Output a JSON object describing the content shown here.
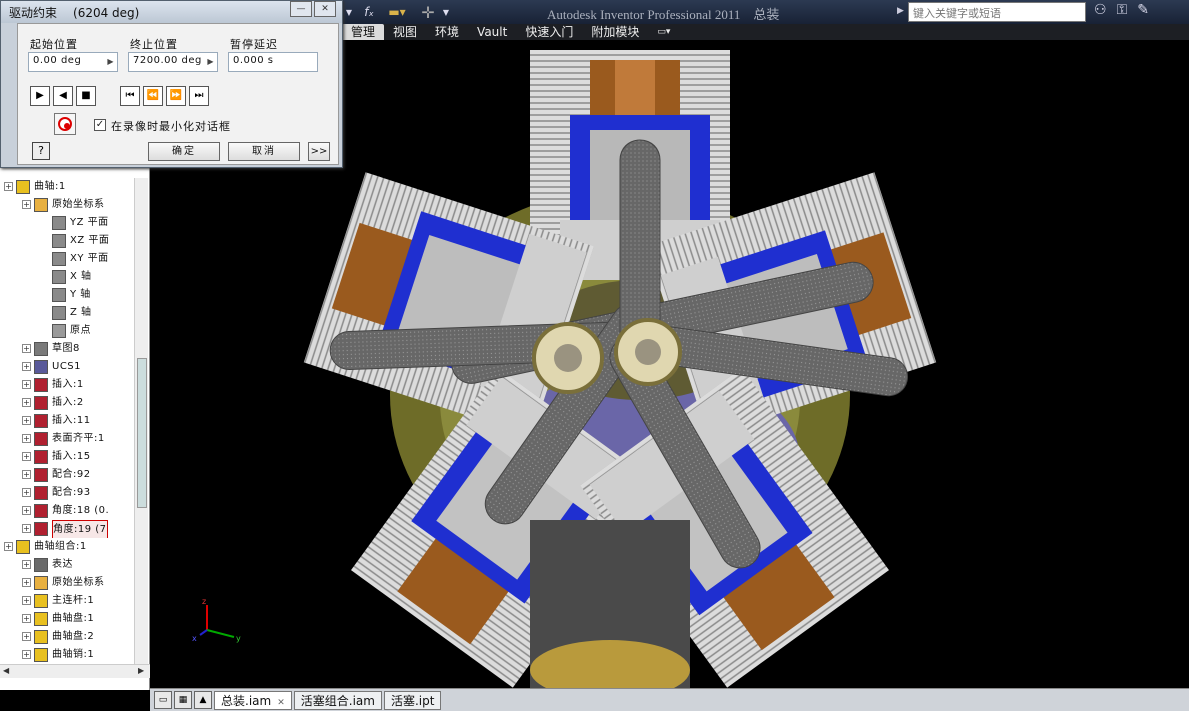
{
  "dialog": {
    "title": "驱动约束",
    "current_value": "(6204 deg)",
    "start_label": "起始位置",
    "start_value": "0.00 deg",
    "end_label": "终止位置",
    "end_value": "7200.00 deg",
    "pause_label": "暂停延迟",
    "pause_value": "0.000 s",
    "record_checkbox_label": "在录像时最小化对话框",
    "record_checkbox_checked": true,
    "ok_label": "确定",
    "cancel_label": "取消",
    "more_label": ">>",
    "help_label": "?"
  },
  "titlebar": {
    "app_title": "Autodesk Inventor Professional 2011",
    "doc_title": "总装",
    "search_placeholder": "键入关键字或短语"
  },
  "menu": [
    "管理",
    "视图",
    "环境",
    "Vault",
    "快速入门",
    "附加模块"
  ],
  "tree": [
    {
      "label": "曲轴:1",
      "indent": 0,
      "icon": "part-icon"
    },
    {
      "label": "原始坐标系",
      "indent": 1,
      "icon": "folder-icon"
    },
    {
      "label": "YZ 平面",
      "indent": 2,
      "icon": "plane-icon"
    },
    {
      "label": "XZ 平面",
      "indent": 2,
      "icon": "plane-icon"
    },
    {
      "label": "XY 平面",
      "indent": 2,
      "icon": "plane-icon"
    },
    {
      "label": "X 轴",
      "indent": 2,
      "icon": "axis-icon"
    },
    {
      "label": "Y 轴",
      "indent": 2,
      "icon": "axis-icon"
    },
    {
      "label": "Z 轴",
      "indent": 2,
      "icon": "axis-icon"
    },
    {
      "label": "原点",
      "indent": 2,
      "icon": "origin-icon"
    },
    {
      "label": "草图8",
      "indent": 1,
      "icon": "sketch-icon"
    },
    {
      "label": "UCS1",
      "indent": 1,
      "icon": "ucs-icon"
    },
    {
      "label": "插入:1",
      "indent": 1,
      "icon": "insert-icon"
    },
    {
      "label": "插入:2",
      "indent": 1,
      "icon": "insert-icon"
    },
    {
      "label": "插入:11",
      "indent": 1,
      "icon": "insert-icon"
    },
    {
      "label": "表面齐平:1",
      "indent": 1,
      "icon": "flush-icon"
    },
    {
      "label": "插入:15",
      "indent": 1,
      "icon": "insert-icon"
    },
    {
      "label": "配合:92",
      "indent": 1,
      "icon": "mate-icon"
    },
    {
      "label": "配合:93",
      "indent": 1,
      "icon": "mate-icon"
    },
    {
      "label": "角度:18 (0.",
      "indent": 1,
      "icon": "angle-icon"
    },
    {
      "label": "角度:19 (7",
      "indent": 1,
      "icon": "angle-icon",
      "selected": true
    },
    {
      "label": "曲轴组合:1",
      "indent": 0,
      "icon": "assembly-icon"
    },
    {
      "label": "表达",
      "indent": 1,
      "icon": "representation-icon"
    },
    {
      "label": "原始坐标系",
      "indent": 1,
      "icon": "folder-icon"
    },
    {
      "label": "主连杆:1",
      "indent": 1,
      "icon": "part-icon"
    },
    {
      "label": "曲轴盘:1",
      "indent": 1,
      "icon": "part-icon"
    },
    {
      "label": "曲轴盘:2",
      "indent": 1,
      "icon": "part-icon"
    },
    {
      "label": "曲轴销:1",
      "indent": 1,
      "icon": "part-icon"
    }
  ],
  "tabs": [
    {
      "label": "总装.iam",
      "active": true
    },
    {
      "label": "活塞组合.iam",
      "active": false
    },
    {
      "label": "活塞.ipt",
      "active": false
    }
  ],
  "colors": {
    "cylinder_blue": "#1f2fd0",
    "rod_gray": "#5a5a5a",
    "housing_olive": "#7c7a2c",
    "piston_copper": "#9a5a1e",
    "fins_white": "#e6e6e6"
  }
}
